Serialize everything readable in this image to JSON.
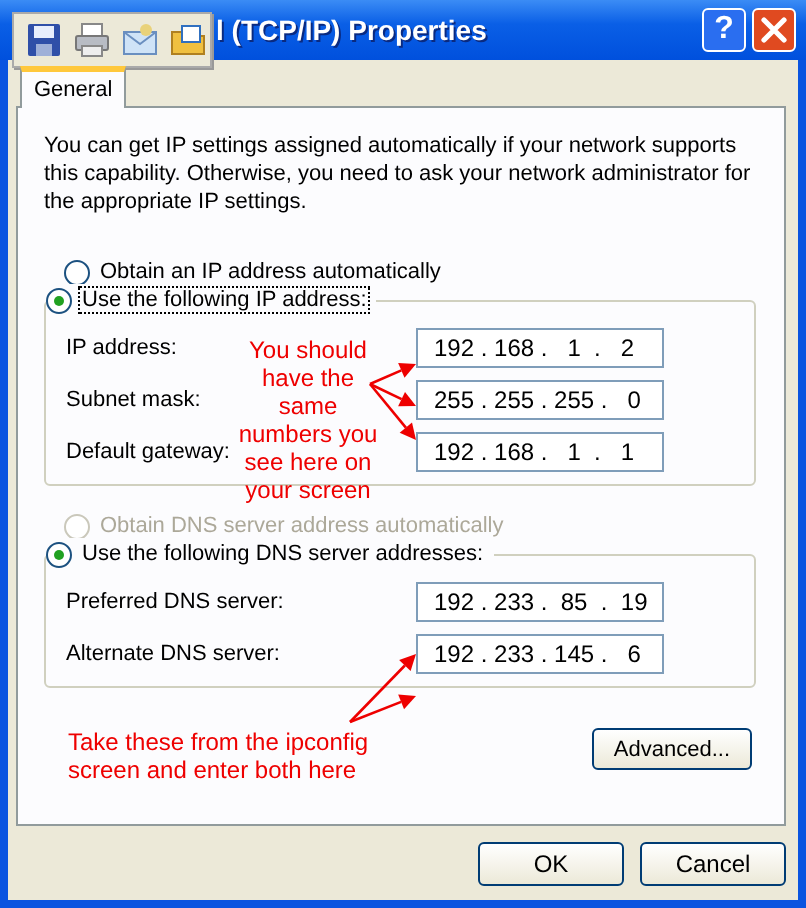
{
  "window": {
    "title": "l (TCP/IP) Properties",
    "help": "?"
  },
  "tabs": [
    {
      "label": "General",
      "selected": true
    }
  ],
  "intro": "You can get IP settings assigned automatically if your network supports this capability. Otherwise, you need to ask your network administrator for the appropriate IP settings.",
  "ip_mode": [
    {
      "label": "Obtain an IP address automatically",
      "selected": false,
      "disabled": false,
      "focused": false
    },
    {
      "label": "Use the following IP address:",
      "selected": true,
      "disabled": false,
      "focused": true
    }
  ],
  "ip_fields": [
    {
      "label": "IP address:",
      "value": "192 . 168 .   1  .   2"
    },
    {
      "label": "Subnet mask:",
      "value": "255 . 255 . 255 .   0"
    },
    {
      "label": "Default gateway:",
      "value": "192 . 168 .   1  .   1"
    }
  ],
  "dns_mode": [
    {
      "label": "Obtain DNS server address automatically",
      "selected": false,
      "disabled": true,
      "focused": false
    },
    {
      "label": "Use the following DNS server addresses:",
      "selected": true,
      "disabled": false,
      "focused": false
    }
  ],
  "dns_fields": [
    {
      "label": "Preferred DNS server:",
      "value": "192 . 233 .  85  .  19"
    },
    {
      "label": "Alternate DNS server:",
      "value": "192 . 233 . 145 .   6"
    }
  ],
  "annotations": [
    {
      "text": "You should\nhave the\nsame\nnumbers you\nsee here on\nyour screen"
    },
    {
      "text": "Take these from the ipconfig\nscreen and enter both here"
    }
  ],
  "advanced_button": "Advanced...",
  "buttons": [
    "OK",
    "Cancel"
  ]
}
